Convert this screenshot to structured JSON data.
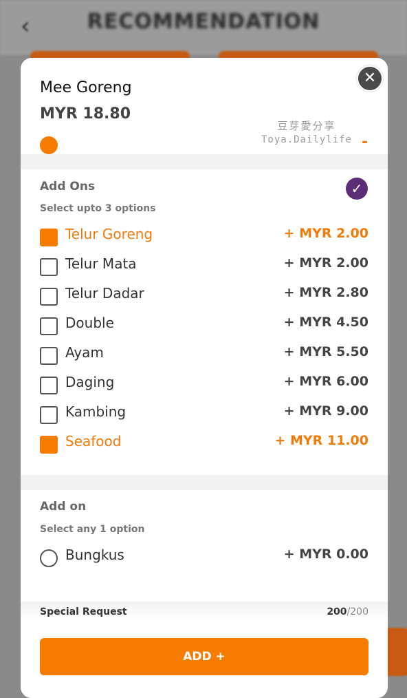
{
  "background": {
    "title": "RECOMMENDATION",
    "back_icon": "chevron-left-icon"
  },
  "item": {
    "name": "Mee Goreng",
    "price": "MYR 18.80",
    "quantity_control": "-"
  },
  "watermark": {
    "line1": "豆芽愛分享",
    "line2": "Toya.Dailylife"
  },
  "addons_group": {
    "title": "Add Ons",
    "subtitle": "Select upto 3 options",
    "options": [
      {
        "label": "Telur Goreng",
        "price": "+ MYR 2.00",
        "checked": true
      },
      {
        "label": "Telur Mata",
        "price": "+ MYR 2.00",
        "checked": false
      },
      {
        "label": "Telur Dadar",
        "price": "+ MYR 2.80",
        "checked": false
      },
      {
        "label": "Double",
        "price": "+ MYR 4.50",
        "checked": false
      },
      {
        "label": "Ayam",
        "price": "+ MYR 5.50",
        "checked": false
      },
      {
        "label": "Daging",
        "price": "+ MYR 6.00",
        "checked": false
      },
      {
        "label": "Kambing",
        "price": "+ MYR 9.00",
        "checked": false
      },
      {
        "label": "Seafood",
        "price": "+ MYR 11.00",
        "checked": true
      }
    ]
  },
  "addon_group": {
    "title": "Add on",
    "subtitle": "Select any 1 option",
    "options": [
      {
        "label": "Bungkus",
        "price": "+ MYR 0.00",
        "selected": false
      }
    ]
  },
  "special_request": {
    "label": "Special Request",
    "count_current": "200",
    "count_max": "/200"
  },
  "add_button": {
    "label": "ADD +"
  },
  "colors": {
    "accent": "#f57c00",
    "badge": "#5b2e75"
  }
}
